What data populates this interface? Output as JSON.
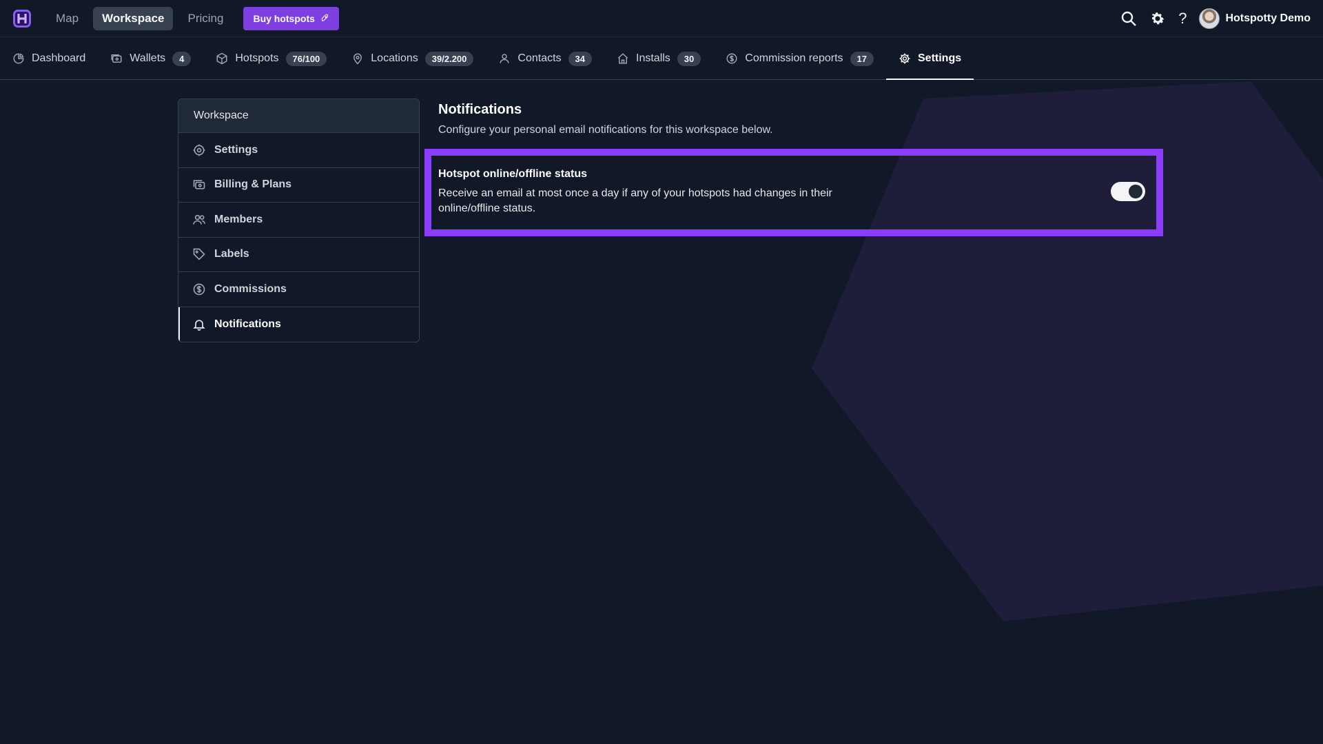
{
  "app": {
    "logo_letter": "H"
  },
  "topnav": {
    "items": [
      {
        "label": "Map"
      },
      {
        "label": "Workspace",
        "active": true
      },
      {
        "label": "Pricing"
      }
    ],
    "buy_button": {
      "label": "Buy hotspots",
      "icon": "rocket-icon"
    }
  },
  "top_right": {
    "search_icon": "search-icon",
    "settings_icon": "gear-icon",
    "help_label": "?",
    "user_name": "Hotspotty Demo"
  },
  "subnav": {
    "items": [
      {
        "label": "Dashboard",
        "icon": "dashboard-icon",
        "badge": ""
      },
      {
        "label": "Wallets",
        "icon": "wallet-icon",
        "badge": "4"
      },
      {
        "label": "Hotspots",
        "icon": "cube-icon",
        "badge": "76/100"
      },
      {
        "label": "Locations",
        "icon": "location-pin-icon",
        "badge": "39/2.200"
      },
      {
        "label": "Contacts",
        "icon": "user-icon",
        "badge": "34"
      },
      {
        "label": "Installs",
        "icon": "home-icon",
        "badge": "30"
      },
      {
        "label": "Commission reports",
        "icon": "dollar-circle-icon",
        "badge": "17"
      },
      {
        "label": "Settings",
        "icon": "gear-icon",
        "badge": "",
        "active": true
      }
    ]
  },
  "sidebar": {
    "header": "Workspace",
    "items": [
      {
        "label": "Settings",
        "icon": "gear-icon"
      },
      {
        "label": "Billing & Plans",
        "icon": "billing-icon"
      },
      {
        "label": "Members",
        "icon": "members-icon"
      },
      {
        "label": "Labels",
        "icon": "tag-icon"
      },
      {
        "label": "Commissions",
        "icon": "dollar-circle-icon"
      },
      {
        "label": "Notifications",
        "icon": "bell-icon",
        "active": true
      }
    ]
  },
  "main": {
    "title": "Notifications",
    "subtitle": "Configure your personal email notifications for this workspace below.",
    "notification": {
      "title": "Hotspot online/offline status",
      "description": "Receive an email at most once a day if any of your hotspots had changes in their online/offline status.",
      "enabled": true
    }
  },
  "colors": {
    "background": "#111827",
    "accent": "#7e3fe0",
    "highlight": "#8b3dff",
    "hexagon": "#1e1d3a"
  }
}
